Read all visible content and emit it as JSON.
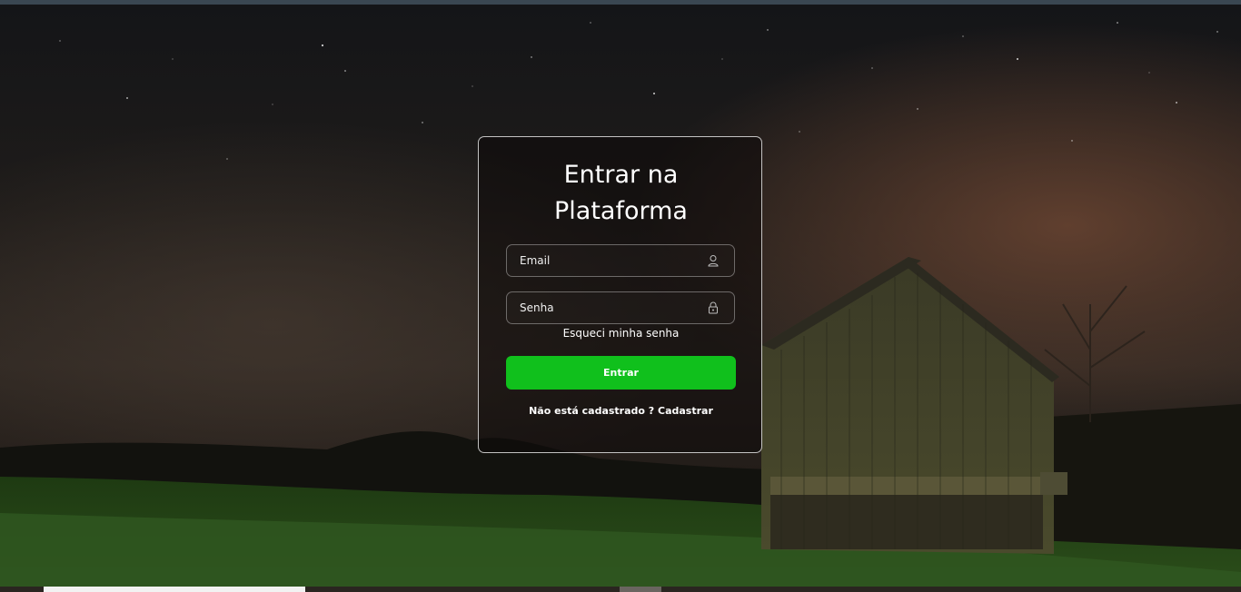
{
  "login": {
    "title_line1": "Entrar na",
    "title_line2": "Plataforma",
    "email_placeholder": "Email",
    "password_placeholder": "Senha",
    "forgot_label": "Esqueci minha senha",
    "submit_label": "Entrar",
    "register_prompt": "Não está cadastrado ?",
    "register_link": "Cadastrar"
  },
  "colors": {
    "accent": "#10c01c"
  },
  "icons": {
    "email": "user-icon",
    "password": "lock-icon"
  }
}
